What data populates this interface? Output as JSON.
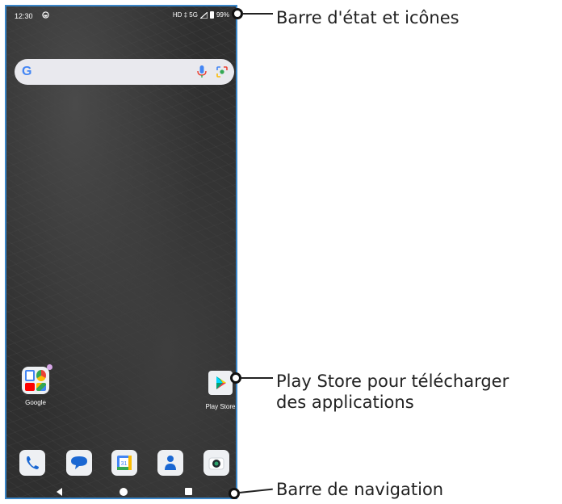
{
  "status_bar": {
    "time": "12:30",
    "right_text": "HD ‡ 5G",
    "battery": "99%"
  },
  "apps": {
    "folder_label": "Google",
    "play_store_label": "Play Store"
  },
  "callouts": {
    "status_bar": "Barre d'état et icônes",
    "play_store_line1": "Play Store pour télécharger",
    "play_store_line2": "des applications",
    "navigation_bar": "Barre de navigation"
  },
  "colors": {
    "frame": "#3a86c8",
    "search_bg": "#e9e9ee"
  },
  "icons": [
    "google-g-icon",
    "mic-icon",
    "lens-icon",
    "phone-icon",
    "messages-icon",
    "calendar-icon",
    "contacts-icon",
    "camera-icon",
    "back-icon",
    "home-icon",
    "recents-icon",
    "play-store-icon"
  ]
}
